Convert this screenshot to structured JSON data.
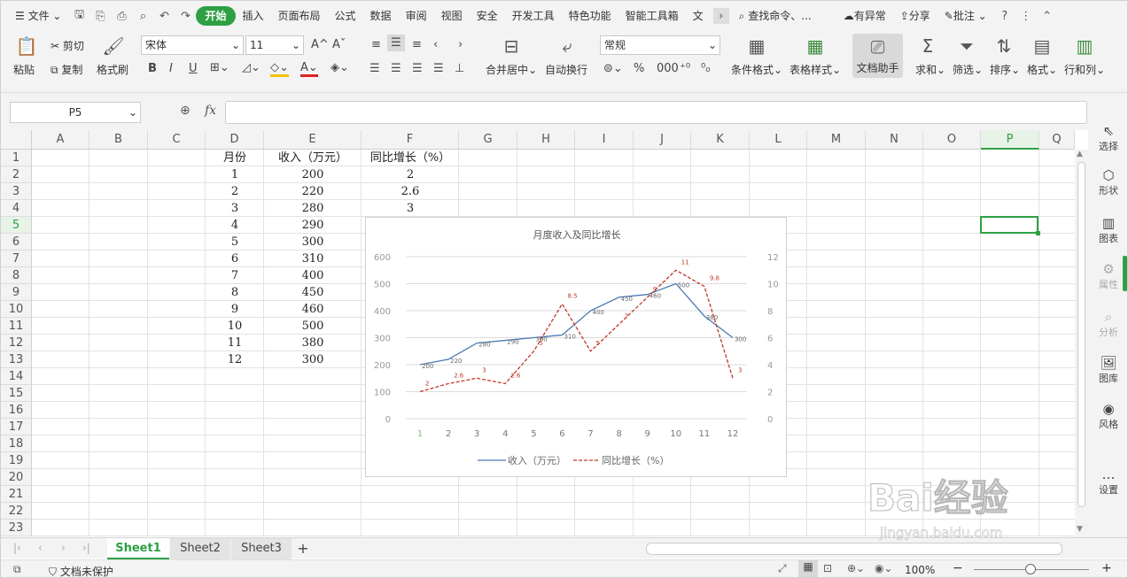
{
  "menubar": {
    "file_label": "文件",
    "tabs": [
      "开始",
      "插入",
      "页面布局",
      "公式",
      "数据",
      "审阅",
      "视图",
      "安全",
      "开发工具",
      "特色功能",
      "智能工具箱",
      "文"
    ],
    "search_label": "查找命令、...",
    "sync_label": "有异常",
    "share_label": "分享",
    "comment_label": "批注"
  },
  "ribbon": {
    "paste": "粘贴",
    "cut": "剪切",
    "copy": "复制",
    "format_painter": "格式刷",
    "font_name": "宋体",
    "font_size": "11",
    "bold": "B",
    "italic": "I",
    "underline": "U",
    "merge": "合并居中",
    "wrap": "自动换行",
    "number_format": "常规",
    "cond_format": "条件格式",
    "table_style": "表格样式",
    "doc_helper": "文档助手",
    "sum": "求和",
    "filter": "筛选",
    "sort": "排序",
    "format": "格式",
    "row_col": "行和列"
  },
  "formula_bar": {
    "cell_ref": "P5",
    "fx": "fx"
  },
  "columns": [
    "A",
    "B",
    "C",
    "D",
    "E",
    "F",
    "G",
    "H",
    "I",
    "J",
    "K",
    "L",
    "M",
    "N",
    "O",
    "P",
    "Q"
  ],
  "rows": [
    "1",
    "2",
    "3",
    "4",
    "5",
    "6",
    "7",
    "8",
    "9",
    "10",
    "11",
    "12",
    "13",
    "14",
    "15",
    "16",
    "17",
    "18",
    "19",
    "20",
    "21",
    "22",
    "23"
  ],
  "table": {
    "headers": [
      "月份",
      "收入（万元）",
      "同比增长（%）"
    ],
    "months": [
      "1",
      "2",
      "3",
      "4",
      "5",
      "6",
      "7",
      "8",
      "9",
      "10",
      "11",
      "12"
    ],
    "income": [
      "200",
      "220",
      "280",
      "290",
      "300",
      "310",
      "400",
      "450",
      "460",
      "500",
      "380",
      "300"
    ],
    "growth": [
      "2",
      "2.6",
      "3"
    ]
  },
  "chart_data": {
    "type": "line",
    "title": "月度收入及同比增长",
    "x": [
      1,
      2,
      3,
      4,
      5,
      6,
      7,
      8,
      9,
      10,
      11,
      12
    ],
    "series": [
      {
        "name": "收入（万元）",
        "axis": "left",
        "color": "#4a7ab4",
        "dash": "solid",
        "values": [
          200,
          220,
          280,
          290,
          300,
          310,
          400,
          450,
          460,
          500,
          380,
          300
        ]
      },
      {
        "name": "同比增长（%）",
        "axis": "right",
        "color": "#c0392b",
        "dash": "dashed",
        "values": [
          2,
          2.6,
          3,
          2.6,
          5,
          8.5,
          5,
          7,
          9,
          11,
          9.8,
          3
        ]
      }
    ],
    "y_left": {
      "min": 0,
      "max": 600,
      "ticks": [
        0,
        100,
        200,
        300,
        400,
        500,
        600
      ]
    },
    "y_right": {
      "min": 0,
      "max": 12,
      "ticks": [
        0,
        2,
        4,
        6,
        8,
        10,
        12
      ]
    },
    "grid": true,
    "legend": "bottom"
  },
  "sheets": {
    "tabs": [
      "Sheet1",
      "Sheet2",
      "Sheet3"
    ],
    "active": "Sheet1",
    "add": "+"
  },
  "right_panel": [
    "选择",
    "形状",
    "图表",
    "属性",
    "分析",
    "图库",
    "风格",
    "设置"
  ],
  "statusbar": {
    "protect": "文档未保护",
    "zoom": "100%"
  },
  "watermark": {
    "text": "Bai经验",
    "url": "jingyan.baidu.com"
  },
  "colors": {
    "accent": "#2ea043",
    "income_line": "#4a7ab4",
    "growth_line": "#c0392b"
  }
}
